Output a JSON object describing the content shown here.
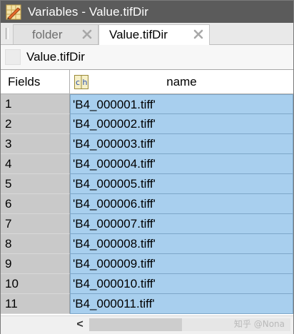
{
  "window": {
    "title": "Variables - Value.tifDir"
  },
  "tabs": [
    {
      "label": "folder",
      "active": false
    },
    {
      "label": "Value.tifDir",
      "active": true
    }
  ],
  "breadcrumb": {
    "label": "Value.tifDir"
  },
  "table": {
    "row_header_label": "Fields",
    "column_type_icon": "ch",
    "column_header": "name",
    "rows": [
      {
        "index": "1",
        "name": "'B4_000001.tiff'"
      },
      {
        "index": "2",
        "name": "'B4_000002.tiff'"
      },
      {
        "index": "3",
        "name": "'B4_000003.tiff'"
      },
      {
        "index": "4",
        "name": "'B4_000004.tiff'"
      },
      {
        "index": "5",
        "name": "'B4_000005.tiff'"
      },
      {
        "index": "6",
        "name": "'B4_000006.tiff'"
      },
      {
        "index": "7",
        "name": "'B4_000007.tiff'"
      },
      {
        "index": "8",
        "name": "'B4_000008.tiff'"
      },
      {
        "index": "9",
        "name": "'B4_000009.tiff'"
      },
      {
        "index": "10",
        "name": "'B4_000010.tiff'"
      },
      {
        "index": "11",
        "name": "'B4_000011.tiff'"
      }
    ]
  },
  "scrollbar": {
    "left_arrow": "<"
  },
  "watermark": "知乎 @Nona",
  "colors": {
    "titlebar": "#5b5b5b",
    "selection": "#a8cfee",
    "rownum_bg": "#c9c9c9"
  }
}
